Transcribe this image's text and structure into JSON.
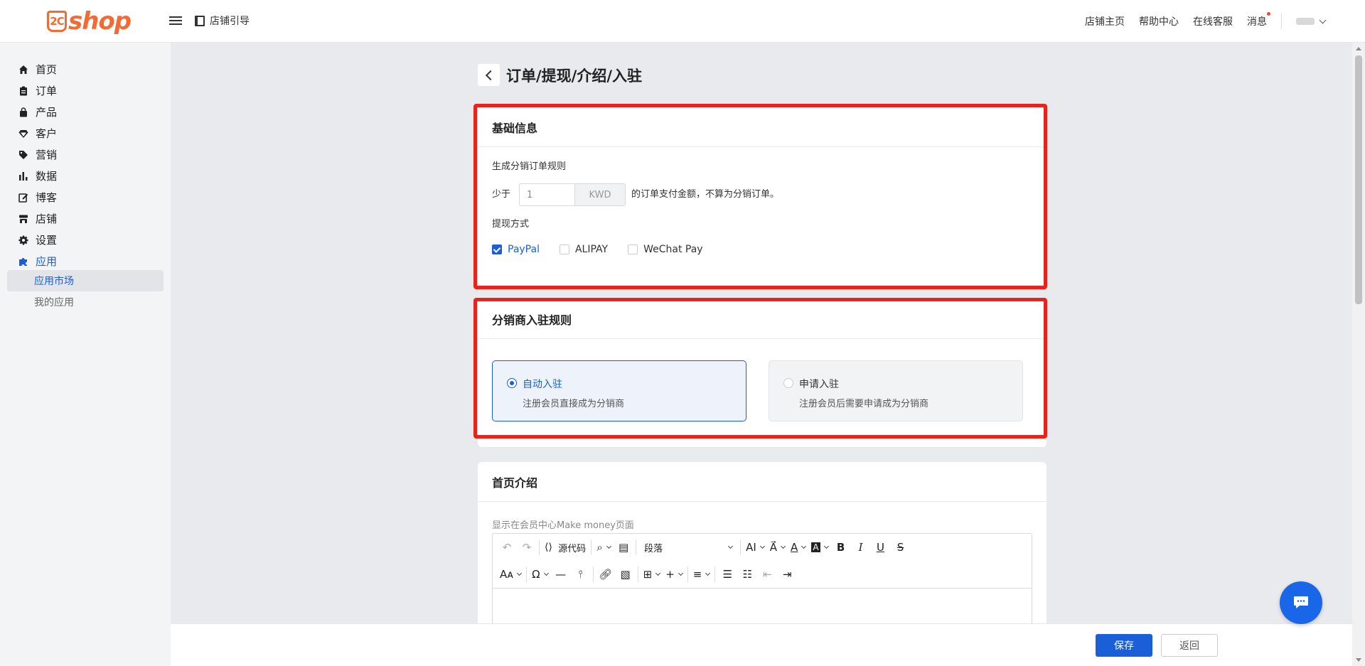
{
  "header": {
    "logo_mark": "2C",
    "logo_text": "shop",
    "guide_label": "店铺引导",
    "links": [
      "店铺主页",
      "帮助中心",
      "在线客服",
      "消息"
    ]
  },
  "sidebar": {
    "items": [
      {
        "label": "首页",
        "icon": "home-icon"
      },
      {
        "label": "订单",
        "icon": "clipboard-icon"
      },
      {
        "label": "产品",
        "icon": "bag-icon"
      },
      {
        "label": "客户",
        "icon": "diamond-icon"
      },
      {
        "label": "营销",
        "icon": "tag-icon"
      },
      {
        "label": "数据",
        "icon": "bar-chart-icon"
      },
      {
        "label": "博客",
        "icon": "edit-icon"
      },
      {
        "label": "店铺",
        "icon": "store-icon"
      },
      {
        "label": "设置",
        "icon": "gear-icon"
      },
      {
        "label": "应用",
        "icon": "puzzle-icon"
      }
    ],
    "sub_items": [
      "应用市场",
      "我的应用"
    ]
  },
  "page": {
    "title": "订单/提现/介绍/入驻"
  },
  "basic": {
    "title": "基础信息",
    "rule_label": "生成分销订单规则",
    "prefix": "少于",
    "amount_value": "1",
    "currency": "KWD",
    "suffix": "的订单支付金额，不算为分销订单。",
    "withdraw_label": "提现方式",
    "methods": [
      {
        "label": "PayPal",
        "checked": true
      },
      {
        "label": "ALIPAY",
        "checked": false
      },
      {
        "label": "WeChat Pay",
        "checked": false
      }
    ]
  },
  "join": {
    "title": "分销商入驻规则",
    "options": [
      {
        "title": "自动入驻",
        "desc": "注册会员直接成为分销商",
        "selected": true
      },
      {
        "title": "申请入驻",
        "desc": "注册会员后需要申请成为分销商",
        "selected": false
      }
    ]
  },
  "intro": {
    "title": "首页介绍",
    "hint": "显示在会员中心Make money页面",
    "source_code_label": "源代码",
    "block_format": "段落"
  },
  "footer": {
    "save_label": "保存",
    "back_label": "返回"
  },
  "colors": {
    "accent": "#1a5fd8",
    "highlight": "#e8231c",
    "brand": "#f26b35"
  }
}
